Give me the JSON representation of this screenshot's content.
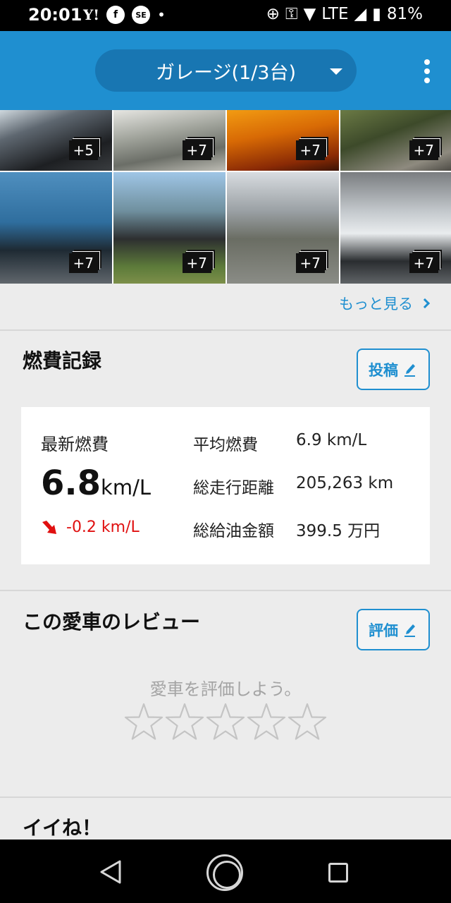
{
  "status_bar": {
    "time": "20:01",
    "left_icons": [
      "Y!",
      "f",
      "SE",
      "•"
    ],
    "network": "LTE",
    "battery": "81%"
  },
  "app_bar": {
    "garage_label": "ガレージ(1/3台)"
  },
  "photos": [
    {
      "count": "+5"
    },
    {
      "count": "+7"
    },
    {
      "count": "+7"
    },
    {
      "count": "+7"
    },
    {
      "count": "+7"
    },
    {
      "count": "+7"
    },
    {
      "count": "+7"
    },
    {
      "count": "+7"
    }
  ],
  "more_link": "もっと見る",
  "fuel": {
    "title": "燃費記録",
    "post_button": "投稿",
    "latest_label": "最新燃費",
    "latest_value": "6.8",
    "latest_unit": "km/L",
    "diff": "-0.2 km/L",
    "stats": [
      {
        "label": "平均燃費",
        "value": "6.9 km/L"
      },
      {
        "label": "総走行距離",
        "value": "205,263 km"
      },
      {
        "label": "総給油金額",
        "value": "399.5 万円"
      }
    ]
  },
  "review": {
    "title": "この愛車のレビュー",
    "rate_button": "評価",
    "prompt": "愛車を評価しよう。",
    "rating": 0,
    "max_rating": 5
  },
  "likes": {
    "title": "イイね！"
  },
  "colors": {
    "brand": "#1f8fd0",
    "diff_negative": "#e01010"
  }
}
